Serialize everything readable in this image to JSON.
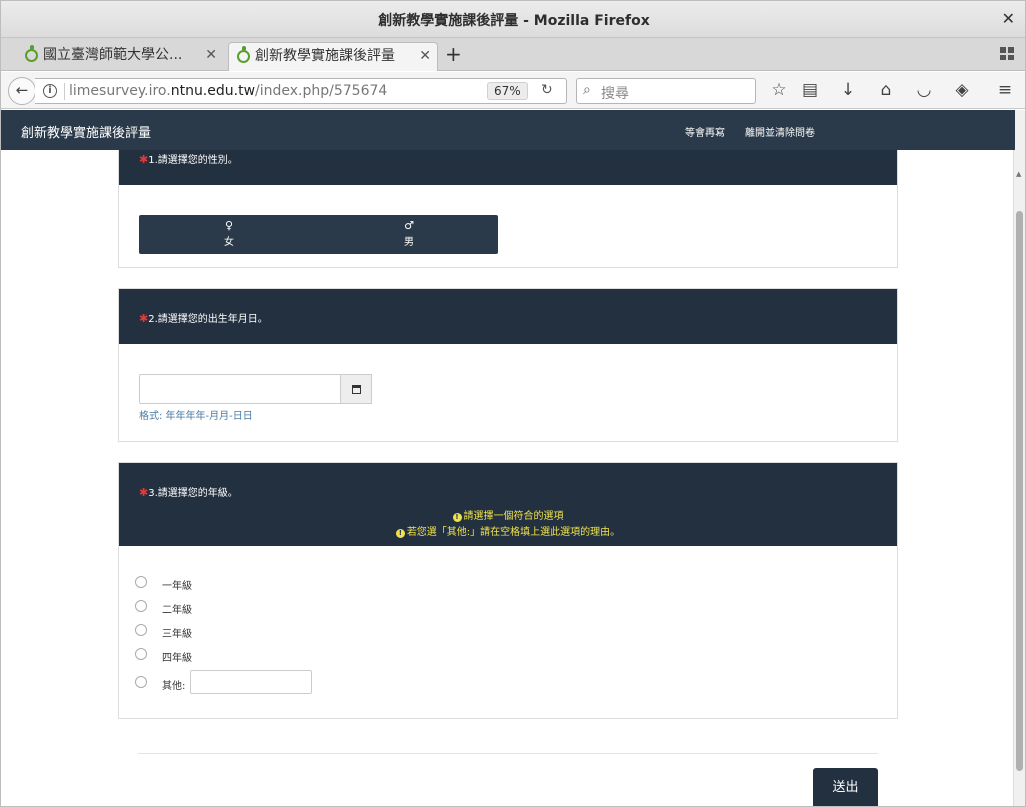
{
  "window": {
    "title": "創新教學實施課後評量 - Mozilla Firefox"
  },
  "tabs": [
    {
      "label": "國立臺灣師範大學公..."
    },
    {
      "label": "創新教學實施課後評量"
    }
  ],
  "navbar": {
    "url_prefix": "limesurvey.iro.",
    "url_domain": "ntnu.edu.tw",
    "url_path": "/index.php/575674",
    "zoom": "67%",
    "search_placeholder": "搜尋"
  },
  "site": {
    "brand": "創新教學實施課後評量",
    "resume_later": "等會再寫",
    "exit_clear": "離開並清除問卷"
  },
  "questions": {
    "q1": {
      "star": "✱",
      "text": "1.請選擇您的性別。",
      "options": [
        {
          "symbol": "♀",
          "label": "女"
        },
        {
          "symbol": "♂",
          "label": "男"
        }
      ]
    },
    "q2": {
      "star": "✱",
      "text": "2.請選擇您的出生年月日。",
      "date_value": "",
      "format_hint": "格式: 年年年年-月月-日日"
    },
    "q3": {
      "star": "✱",
      "text": "3.請選擇您的年級。",
      "tip1": "請選擇一個符合的選項",
      "tip2": "若您選「其他:」請在空格填上選此選項的理由。",
      "options": [
        "一年級",
        "二年級",
        "三年級",
        "四年級",
        "其他:"
      ],
      "other_value": ""
    }
  },
  "submit_label": "送出"
}
